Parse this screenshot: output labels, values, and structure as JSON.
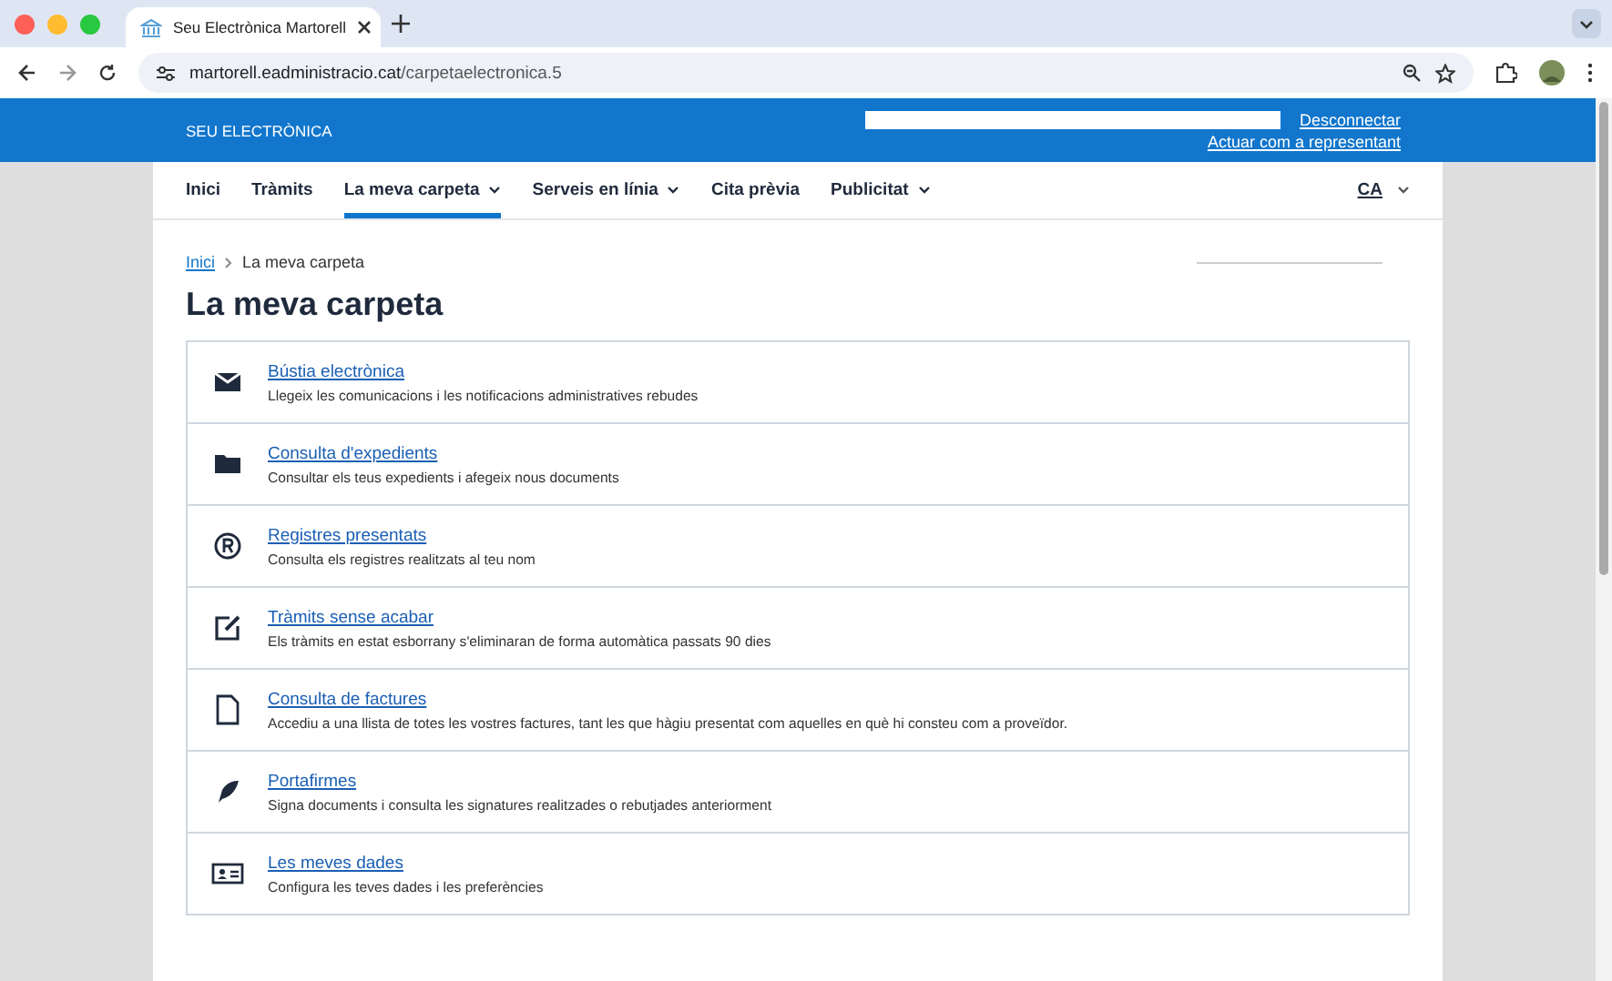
{
  "browser": {
    "tab_title": "Seu Electrònica Martorell",
    "url_host": "martorell.eadministracio.cat",
    "url_path": "/carpetaelectronica.5"
  },
  "header": {
    "brand": "SEU ELECTRÒNICA",
    "links": [
      "Desconnectar",
      "Actuar com a representant"
    ]
  },
  "nav": {
    "items": [
      {
        "label": "Inici",
        "selected": false,
        "has_menu": false
      },
      {
        "label": "Tràmits",
        "selected": false,
        "has_menu": false
      },
      {
        "label": "La meva carpeta",
        "selected": true,
        "has_menu": true
      },
      {
        "label": "Serveis en línia",
        "selected": false,
        "has_menu": true
      },
      {
        "label": "Cita prèvia",
        "selected": false,
        "has_menu": false
      },
      {
        "label": "Publicitat",
        "selected": false,
        "has_menu": true
      }
    ],
    "language": "CA"
  },
  "breadcrumb": [
    "Inici",
    "La meva carpeta"
  ],
  "title": "La meva carpeta",
  "items": [
    {
      "kind": "mail",
      "title": "Bústia electrònica",
      "description": "Llegeix les comunicacions i les notificacions administratives rebudes"
    },
    {
      "kind": "folder",
      "title": "Consulta d'expedients",
      "description": "Consultar els teus expedients i afegeix nous documents"
    },
    {
      "kind": "registered",
      "title": "Registres presentats",
      "description": "Consulta els registres realitzats al teu nom"
    },
    {
      "kind": "edit",
      "title": "Tràmits sense acabar",
      "description": "Els tràmits en estat esborrany s'eliminaran de forma automàtica passats 90 dies"
    },
    {
      "kind": "document",
      "title": "Consulta de factures",
      "description": "Accediu a una llista de totes les vostres factures, tant les que hàgiu presentat com aquelles en què hi consteu com a proveïdor."
    },
    {
      "kind": "pen",
      "title": "Portafirmes",
      "description": "Signa documents i consulta les signatures realitzades o rebutjades anteriorment"
    },
    {
      "kind": "card",
      "title": "Les meves dades",
      "description": "Configura les teves dades i les preferències"
    }
  ]
}
